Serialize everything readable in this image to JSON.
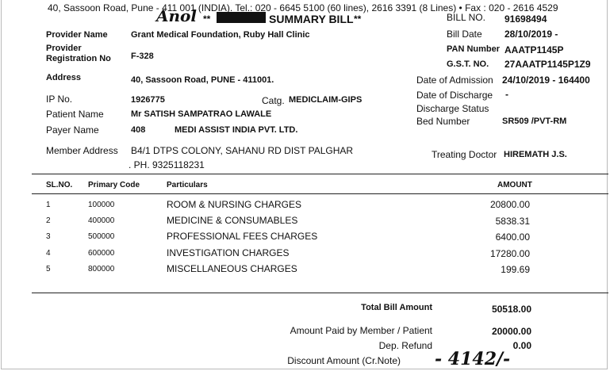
{
  "top_address_line": "40, Sassoon Road, Pune - 411 001 (INDIA). Tel.: 020 - 6645 5100 (60 lines), 2616 3391 (8 Lines) • Fax : 020 - 2616 4529",
  "handwritten_top": "Anol",
  "title": "SUMMARY BILL",
  "title_stars_left": "**",
  "title_stars_right": "**",
  "provider": {
    "name_label": "Provider Name",
    "name_value": "Grant Medical Foundation, Ruby Hall Clinic",
    "reg_label_line1": "Provider",
    "reg_label_line2": "Registration No",
    "reg_value": "F-328",
    "address_label": "Address",
    "address_value": "40, Sassoon Road, PUNE - 411001."
  },
  "bill_info": {
    "bill_no_label": "BILL NO.",
    "bill_no_value": "91698494",
    "bill_date_label": "Bill Date",
    "bill_date_value": "28/10/2019 -",
    "pan_label": "PAN Number",
    "pan_value": "AAATP1145P",
    "gst_label": "G.S.T. NO.",
    "gst_value": "27AAATP1145P1Z9",
    "admission_label": "Date of Admission",
    "admission_value": "24/10/2019 - 164400",
    "discharge_label": "Date of Discharge",
    "discharge_value": "-",
    "discharge_status_label": "Discharge Status",
    "bed_label": "Bed Number",
    "bed_value": "SR509 /PVT-RM"
  },
  "patient": {
    "ip_label": "IP No.",
    "ip_value": "1926775",
    "catg_label": "Catg.",
    "catg_value": "MEDICLAIM-GIPS",
    "name_label": "Patient Name",
    "name_value": "Mr SATISH SAMPATRAO LAWALE",
    "payer_label": "Payer Name",
    "payer_code": "408",
    "payer_value": "MEDI ASSIST INDIA PVT. LTD.",
    "member_address_label": "Member Address",
    "member_address_line1": "B4/1 DTPS COLONY, SAHANU RD DIST PALGHAR",
    "member_address_line2": ". PH. 9325118231",
    "doctor_label": "Treating Doctor",
    "doctor_value": "HIREMATH J.S."
  },
  "table": {
    "headers": {
      "sl": "SL.NO.",
      "code": "Primary Code",
      "particulars": "Particulars",
      "amount": "AMOUNT"
    },
    "rows": [
      {
        "sl": "1",
        "code": "100000",
        "particulars": "ROOM & NURSING CHARGES",
        "amount": "20800.00"
      },
      {
        "sl": "2",
        "code": "400000",
        "particulars": "MEDICINE & CONSUMABLES",
        "amount": "5838.31"
      },
      {
        "sl": "3",
        "code": "500000",
        "particulars": "PROFESSIONAL FEES CHARGES",
        "amount": "6400.00"
      },
      {
        "sl": "4",
        "code": "600000",
        "particulars": "INVESTIGATION CHARGES",
        "amount": "17280.00"
      },
      {
        "sl": "5",
        "code": "800000",
        "particulars": "MISCELLANEOUS CHARGES",
        "amount": "199.69"
      }
    ]
  },
  "totals": {
    "total_label": "Total Bill Amount",
    "total_value": "50518.00",
    "paid_label": "Amount Paid by Member / Patient",
    "paid_value": "20000.00",
    "refund_label": "Dep. Refund",
    "refund_value": "0.00",
    "discount_label": "Discount Amount (Cr.Note)",
    "discount_handwritten": "- 4142/-"
  }
}
